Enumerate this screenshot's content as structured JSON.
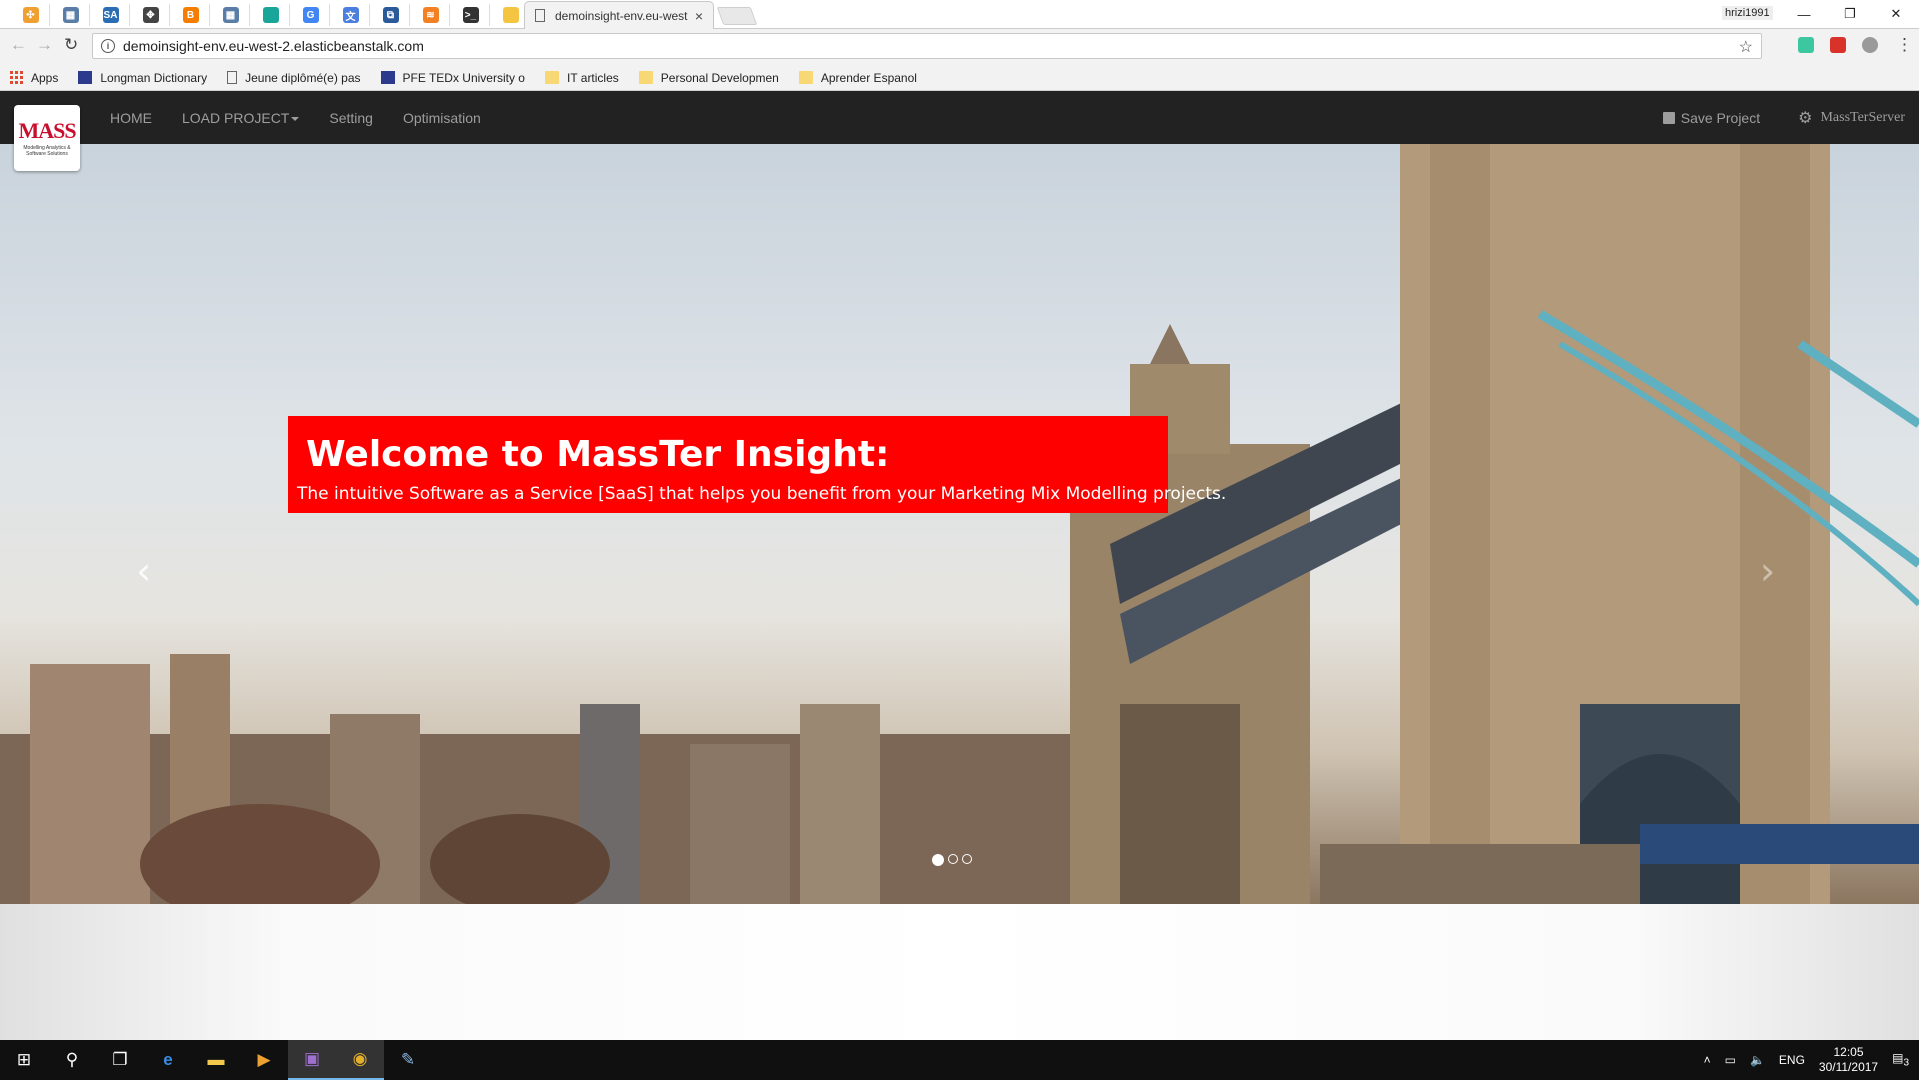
{
  "browser": {
    "pinned_tabs": [
      {
        "icon": "puzzle-orange-icon",
        "color": "#f0a030",
        "glyph": "✣"
      },
      {
        "icon": "tree-icon",
        "color": "#5a7da8",
        "glyph": "▦"
      },
      {
        "icon": "sa-icon",
        "color": "#2a6db5",
        "glyph": "SA"
      },
      {
        "icon": "network-icon",
        "color": "#444444",
        "glyph": "✥"
      },
      {
        "icon": "blogger-icon",
        "color": "#f57d00",
        "glyph": "B"
      },
      {
        "icon": "tree-icon",
        "color": "#5a7da8",
        "glyph": "▦"
      },
      {
        "icon": "square-teal-icon",
        "color": "#1aa59a",
        "glyph": ""
      },
      {
        "icon": "google-icon",
        "color": "#4285f4",
        "glyph": "G"
      },
      {
        "icon": "translate-icon",
        "color": "#4a7fe0",
        "glyph": "文"
      },
      {
        "icon": "powershell-icon",
        "color": "#2a5a9a",
        "glyph": "⧉"
      },
      {
        "icon": "stack-icon",
        "color": "#f48024",
        "glyph": "≋"
      },
      {
        "icon": "terminal-icon",
        "color": "#333333",
        "glyph": ">_"
      },
      {
        "icon": "note-icon",
        "color": "#f5c542",
        "glyph": ""
      }
    ],
    "active_tab": {
      "title": "demoinsight-env.eu-west",
      "close": "×"
    },
    "profile": "hrizi1991",
    "window_controls": {
      "minimize": "—",
      "restore": "❐",
      "close": "✕"
    },
    "url": "demoinsight-env.eu-west-2.elasticbeanstalk.com",
    "nav": {
      "back": "←",
      "forward": "→",
      "reload": "↻"
    },
    "star": "☆",
    "bookmarks": [
      {
        "label": "Apps",
        "kind": "apps"
      },
      {
        "label": "Longman Dictionary",
        "kind": "favicon"
      },
      {
        "label": "Jeune diplômé(e) pas",
        "kind": "page"
      },
      {
        "label": "PFE TEDx University o",
        "kind": "favicon"
      },
      {
        "label": "IT articles",
        "kind": "folder"
      },
      {
        "label": "Personal Developmen",
        "kind": "folder"
      },
      {
        "label": "Aprender Espanol",
        "kind": "folder"
      }
    ]
  },
  "site": {
    "logo_text": "MASS",
    "logo_sub": "Modelling Analytics & Software Solutions",
    "nav": {
      "home": "HOME",
      "load_project": "LOAD PROJECT",
      "setting": "Setting",
      "optimisation": "Optimisation"
    },
    "save_project": "Save Project",
    "server_name": "MassTerServer"
  },
  "carousel": {
    "title": "Welcome to MassTer Insight:",
    "subtitle": "The intuitive Software as a Service [SaaS] that helps you benefit from your Marketing Mix Modelling projects.",
    "prev": "‹",
    "next": "›",
    "slide_count": 3,
    "active_slide": 1
  },
  "taskbar": {
    "tray_lang": "ENG",
    "time": "12:05",
    "date": "30/11/2017",
    "notifications": "3"
  }
}
